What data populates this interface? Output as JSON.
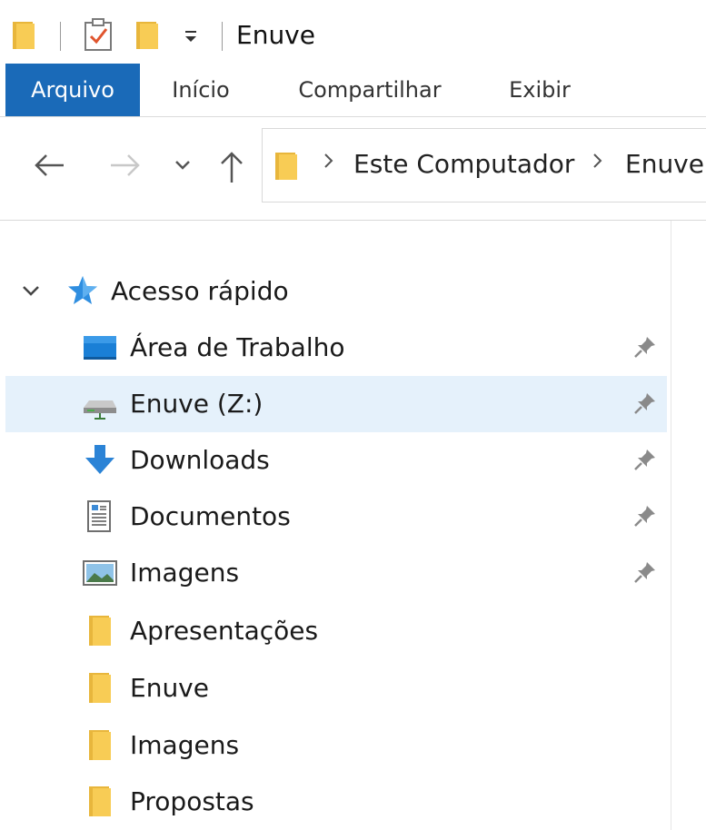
{
  "window": {
    "title": "Enuve"
  },
  "ribbon": {
    "tabs": [
      {
        "label": "Arquivo",
        "active": true
      },
      {
        "label": "Início"
      },
      {
        "label": "Compartilhar"
      },
      {
        "label": "Exibir"
      }
    ]
  },
  "address_bar": {
    "breadcrumbs": [
      "Este Computador",
      "Enuve"
    ]
  },
  "navigation_pane": {
    "quick_access": {
      "label": "Acesso rápido",
      "expanded": true,
      "items": [
        {
          "label": "Área de Trabalho",
          "icon": "desktop-icon",
          "pinned": true
        },
        {
          "label": "Enuve (Z:)",
          "icon": "network-drive-icon",
          "pinned": true,
          "selected": true
        },
        {
          "label": "Downloads",
          "icon": "downloads-icon",
          "pinned": true
        },
        {
          "label": "Documentos",
          "icon": "documents-icon",
          "pinned": true
        },
        {
          "label": "Imagens",
          "icon": "pictures-icon",
          "pinned": true
        },
        {
          "label": "Apresentações",
          "icon": "folder-icon",
          "pinned": false
        },
        {
          "label": "Enuve",
          "icon": "folder-icon",
          "pinned": false
        },
        {
          "label": "Imagens",
          "icon": "folder-icon",
          "pinned": false
        },
        {
          "label": "Propostas",
          "icon": "folder-icon",
          "pinned": false
        }
      ]
    }
  },
  "colors": {
    "file_tab": "#1a6ab8",
    "selection": "#e5f1fb",
    "folder": "#f7c948"
  }
}
